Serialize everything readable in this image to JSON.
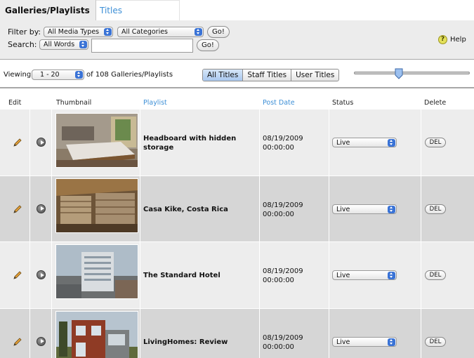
{
  "tabs": [
    {
      "label": "Galleries/Playlists",
      "active": true
    },
    {
      "label": "Titles",
      "active": false
    }
  ],
  "filter": {
    "filter_by_label": "Filter by:",
    "media_type": "All Media Types",
    "category": "All Categories",
    "go_label": "Go!",
    "search_label": "Search:",
    "search_mode": "All Words",
    "search_value": "",
    "help_label": "Help"
  },
  "viewing": {
    "label": "Viewing",
    "range": "1 - 20",
    "of_text": "of 108 Galleries/Playlists",
    "segments": [
      {
        "label": "All Titles",
        "active": true
      },
      {
        "label": "Staff Titles",
        "active": false
      },
      {
        "label": "User Titles",
        "active": false
      }
    ],
    "slider_value": 0.38
  },
  "table": {
    "columns": {
      "edit": "Edit",
      "thumbnail": "Thumbnail",
      "playlist": "Playlist",
      "post_date": "Post Date",
      "status": "Status",
      "delete": "Delete"
    },
    "rows": [
      {
        "title": "Headboard with hidden storage",
        "date": "08/19/2009",
        "time": "00:00:00",
        "status": "Live",
        "delete_label": "DEL"
      },
      {
        "title": "Casa Kike, Costa Rica",
        "date": "08/19/2009",
        "time": "00:00:00",
        "status": "Live",
        "delete_label": "DEL"
      },
      {
        "title": "The Standard Hotel",
        "date": "08/19/2009",
        "time": "00:00:00",
        "status": "Live",
        "delete_label": "DEL"
      },
      {
        "title": "LivingHomes: Review",
        "date": "08/19/2009",
        "time": "00:00:00",
        "status": "Live",
        "delete_label": "DEL"
      }
    ]
  },
  "colors": {
    "link_blue": "#3d8fd6",
    "select_blue": "#3a73d6",
    "row_light": "#ededed",
    "row_dark": "#d6d6d6"
  }
}
